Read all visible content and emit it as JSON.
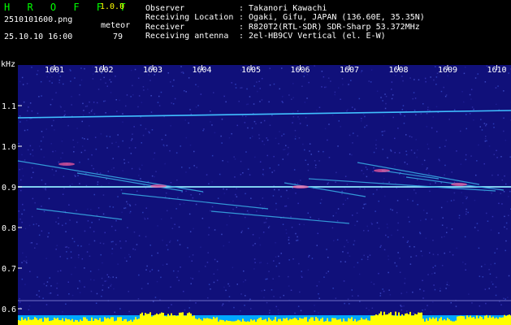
{
  "header": {
    "app_title": "H R O F F T",
    "version": "1.0.0",
    "filename": "2510101600.png",
    "datetime": "25.10.10 16:00",
    "mode": "meteor",
    "count": "79"
  },
  "info": [
    {
      "label": "Observer",
      "value": ": Takanori Kawachi"
    },
    {
      "label": "Receiving Location",
      "value": ": Ogaki, Gifu, JAPAN (136.60E, 35.35N)"
    },
    {
      "label": "Receiver",
      "value": ": R820T2(RTL-SDR) SDR-Sharp 53.372MHz"
    },
    {
      "label": "Receiving antenna",
      "value": ": 2el-HB9CV Vertical (el. E-W)"
    }
  ],
  "axis": {
    "unit": "kHz",
    "x_ticks": [
      "1601",
      "1602",
      "1603",
      "1604",
      "1605",
      "1606",
      "1607",
      "1608",
      "1609",
      "1610"
    ],
    "y_ticks": [
      "1.1",
      "1.0",
      "0.9",
      "0.8",
      "0.7",
      "0.6"
    ]
  },
  "colors": {
    "header_green": "#00ff00",
    "version_yellow": "#ffff00",
    "plot_bg": "#10107a",
    "signal_cyan": "#40c0ff",
    "level_yellow": "#ffff00"
  }
}
